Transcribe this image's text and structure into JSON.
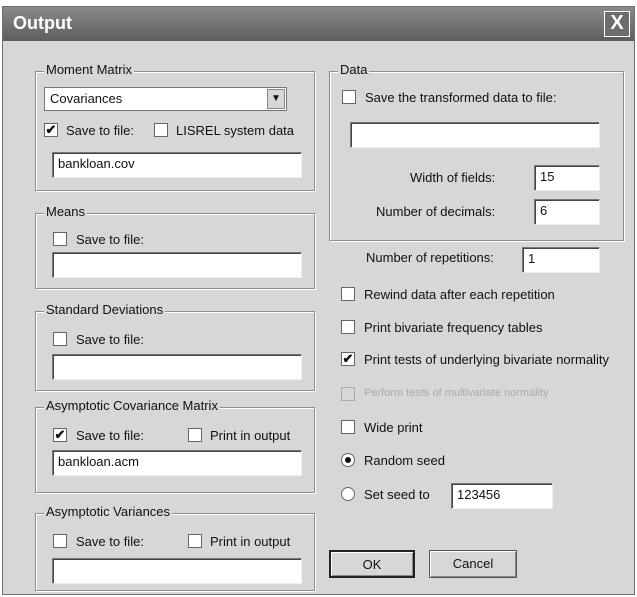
{
  "window": {
    "title": "Output",
    "close_glyph": "X"
  },
  "moment_matrix": {
    "legend": "Moment Matrix",
    "select_value": "Covariances",
    "save_label": "Save to file:",
    "save_checked": true,
    "lisrel_label": "LISREL system data",
    "lisrel_checked": false,
    "file_value": "bankloan.cov"
  },
  "means": {
    "legend": "Means",
    "save_label": "Save to file:",
    "save_checked": false,
    "file_value": ""
  },
  "std_dev": {
    "legend": "Standard Deviations",
    "save_label": "Save to file:",
    "save_checked": false,
    "file_value": ""
  },
  "asym_cov": {
    "legend": "Asymptotic Covariance Matrix",
    "save_label": "Save to file:",
    "save_checked": true,
    "print_label": "Print in output",
    "print_checked": false,
    "file_value": "bankloan.acm"
  },
  "asym_var": {
    "legend": "Asymptotic Variances",
    "save_label": "Save to file:",
    "save_checked": false,
    "print_label": "Print in output",
    "print_checked": false,
    "file_value": ""
  },
  "data": {
    "legend": "Data",
    "save_label": "Save the transformed data to file:",
    "save_checked": false,
    "file_value": "",
    "width_label": "Width of fields:",
    "width_value": "15",
    "decimals_label": "Number of decimals:",
    "decimals_value": "6"
  },
  "options": {
    "repetitions_label": "Number of repetitions:",
    "repetitions_value": "1",
    "rewind_label": "Rewind data after each repetition",
    "rewind_checked": false,
    "bivariate_freq_label": "Print bivariate frequency tables",
    "bivariate_freq_checked": false,
    "tests_label": "Print tests of underlying bivariate normality",
    "tests_checked": true,
    "multivariate_label": "Perform tests of multivariate normality",
    "multivariate_checked": false,
    "wide_label": "Wide print",
    "wide_checked": false,
    "random_seed_label": "Random seed",
    "random_seed_selected": true,
    "set_seed_label": "Set seed to",
    "set_seed_selected": false,
    "seed_value": "123456"
  },
  "buttons": {
    "ok": "OK",
    "cancel": "Cancel"
  },
  "icons": {
    "checkbox_checked": "check-icon",
    "dropdown": "chevron-down-icon",
    "close": "close-icon"
  }
}
